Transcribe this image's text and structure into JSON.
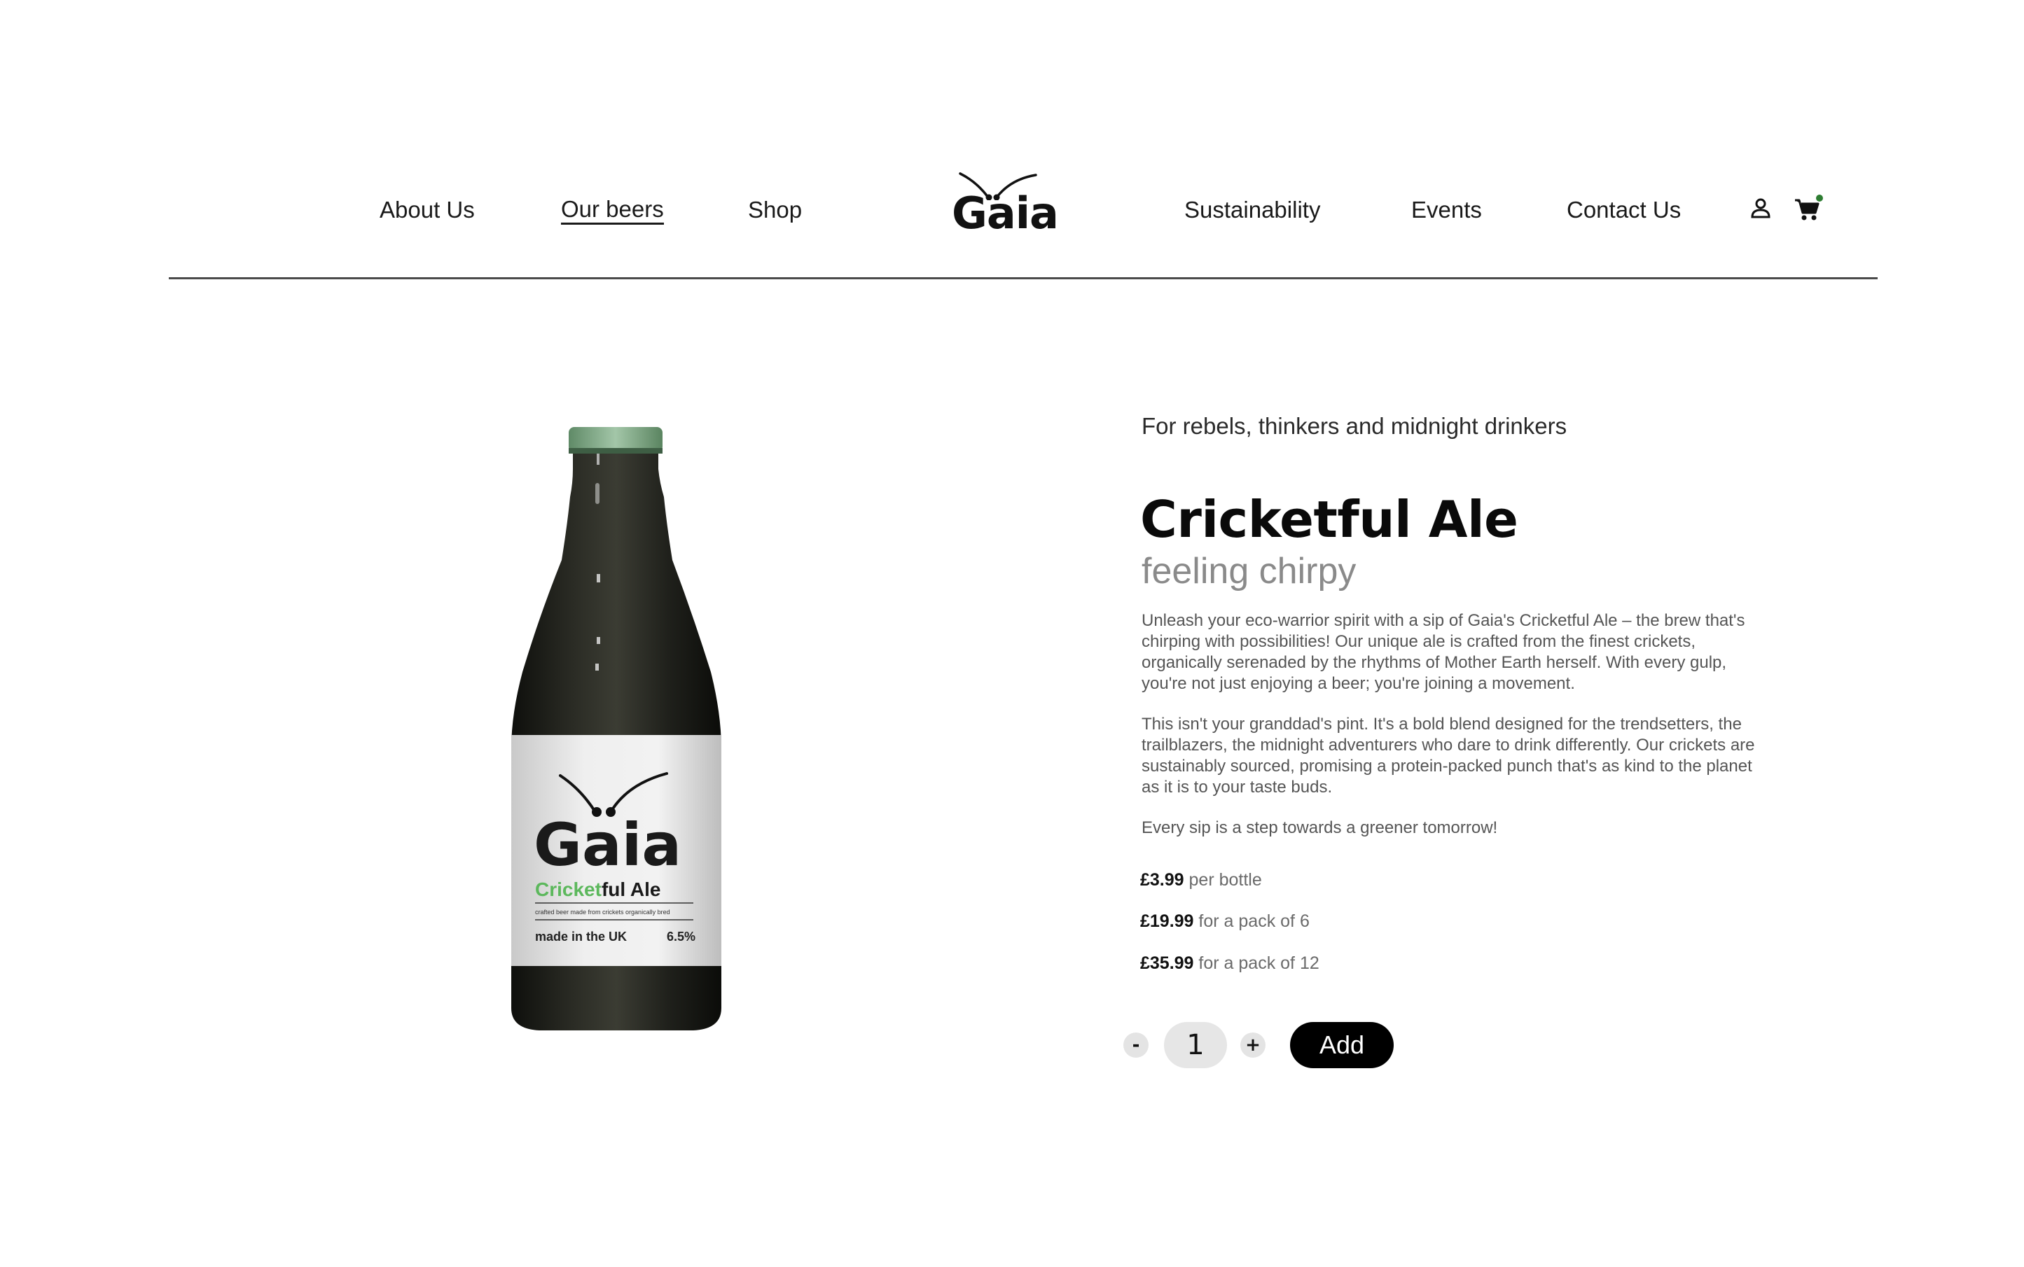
{
  "nav": {
    "left": [
      {
        "label": "About Us"
      },
      {
        "label": "Our beers",
        "active": true
      },
      {
        "label": "Shop"
      }
    ],
    "right": [
      {
        "label": "Sustainability"
      },
      {
        "label": "Events"
      },
      {
        "label": "Contact Us"
      }
    ],
    "logo_text": "Gaia",
    "icons": [
      "user-icon",
      "cart-icon"
    ],
    "cart_badge_color": "#2e7d32"
  },
  "product": {
    "tagline": "For rebels, thinkers and midnight drinkers",
    "title": "Cricketful Ale",
    "subtitle": "feeling chirpy",
    "description": [
      "Unleash your eco-warrior spirit with a sip of Gaia's Cricketful Ale – the brew that's chirping with possibilities! Our unique ale is crafted from the finest crickets, organically serenaded by the rhythms of Mother Earth herself. With every gulp, you're not just enjoying a beer; you're joining a movement.",
      "This isn't your granddad's pint. It's a bold blend designed for the trendsetters, the trailblazers, the midnight adventurers who dare to drink differently. Our crickets are sustainably sourced, promising a protein-packed punch that's as kind to the planet as it is to your taste buds.",
      "Every sip is a step towards a greener tomorrow!"
    ],
    "prices": [
      {
        "amount": "£3.99",
        "unit": "per bottle"
      },
      {
        "amount": "£19.99",
        "unit": "for a pack of 6"
      },
      {
        "amount": "£35.99",
        "unit": "for a pack of 12"
      }
    ],
    "quantity": "1",
    "minus_label": "-",
    "plus_label": "+",
    "add_label": "Add"
  },
  "bottle_label": {
    "brand": "Gaia",
    "name_green": "Cricket",
    "name_black": "ful Ale",
    "small_print": "crafted beer made from crickets organically bred",
    "origin": "made in the UK",
    "abv": "6.5%",
    "cap_color": "#7fa886",
    "accent_green": "#5cb85c"
  }
}
